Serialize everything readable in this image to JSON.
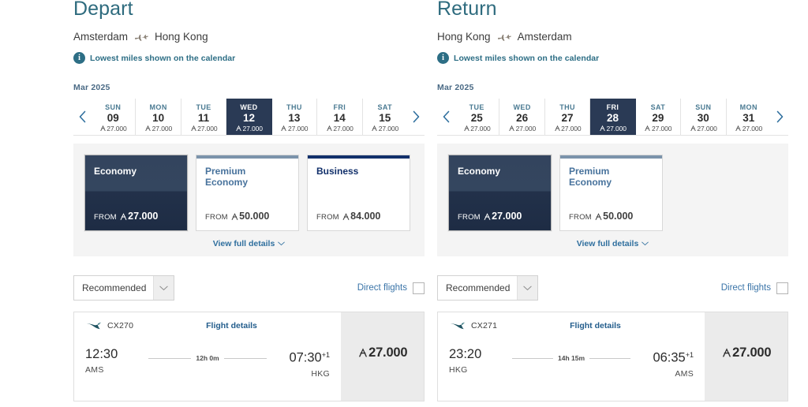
{
  "brand": {
    "accent_teal": "#2e6b7e",
    "accent_blue": "#2f6f9e",
    "navy_dark": "#2a3a55",
    "business_navy": "#12306b",
    "premium_blue": "#7b93ab",
    "miles_symbol": "asia-miles-A"
  },
  "panels": [
    {
      "key": "depart",
      "title": "Depart",
      "route": {
        "origin": "Amsterdam",
        "destination": "Hong Kong",
        "icon": "airplane-icon"
      },
      "notice": {
        "icon": "info-icon",
        "text": "Lowest miles shown on the calendar"
      },
      "month": "Mar 2025",
      "calendar": {
        "prev_label": "‹",
        "next_label": "›",
        "days": [
          {
            "dow": "SUN",
            "num": "09",
            "miles": "27.000",
            "selected": false
          },
          {
            "dow": "MON",
            "num": "10",
            "miles": "27.000",
            "selected": false
          },
          {
            "dow": "TUE",
            "num": "11",
            "miles": "27.000",
            "selected": false
          },
          {
            "dow": "WED",
            "num": "12",
            "miles": "27.000",
            "selected": true
          },
          {
            "dow": "THU",
            "num": "13",
            "miles": "27.000",
            "selected": false
          },
          {
            "dow": "FRI",
            "num": "14",
            "miles": "27.000",
            "selected": false
          },
          {
            "dow": "SAT",
            "num": "15",
            "miles": "27.000",
            "selected": false
          }
        ]
      },
      "cabins": [
        {
          "name": "Economy",
          "from_label": "FROM",
          "price": "27.000",
          "state": "selected"
        },
        {
          "name": "Premium Economy",
          "from_label": "FROM",
          "price": "50.000",
          "state": "premium"
        },
        {
          "name": "Business",
          "from_label": "FROM",
          "price": "84.000",
          "state": "business"
        }
      ],
      "view_details": {
        "label": "View full details",
        "icon": "chevron-down-icon"
      },
      "filters": {
        "sort_value": "Recommended",
        "sort_caret": "chevron-down-icon",
        "direct_label": "Direct flights",
        "direct_checked": false
      },
      "flight": {
        "carrier_icon": "cathay-brushwing-icon",
        "flight_number": "CX270",
        "details_link": "Flight details",
        "depart_time": "12:30",
        "depart_airport": "AMS",
        "duration": "12h 0m",
        "arrive_time": "07:30",
        "arrive_day_offset": "+1",
        "arrive_airport": "HKG",
        "price": "27.000"
      }
    },
    {
      "key": "return",
      "title": "Return",
      "route": {
        "origin": "Hong Kong",
        "destination": "Amsterdam",
        "icon": "airplane-icon"
      },
      "notice": {
        "icon": "info-icon",
        "text": "Lowest miles shown on the calendar"
      },
      "month": "Mar 2025",
      "calendar": {
        "prev_label": "‹",
        "next_label": "›",
        "days": [
          {
            "dow": "TUE",
            "num": "25",
            "miles": "27.000",
            "selected": false
          },
          {
            "dow": "WED",
            "num": "26",
            "miles": "27.000",
            "selected": false
          },
          {
            "dow": "THU",
            "num": "27",
            "miles": "27.000",
            "selected": false
          },
          {
            "dow": "FRI",
            "num": "28",
            "miles": "27.000",
            "selected": true
          },
          {
            "dow": "SAT",
            "num": "29",
            "miles": "27.000",
            "selected": false
          },
          {
            "dow": "SUN",
            "num": "30",
            "miles": "27.000",
            "selected": false
          },
          {
            "dow": "MON",
            "num": "31",
            "miles": "27.000",
            "selected": false
          }
        ]
      },
      "cabins": [
        {
          "name": "Economy",
          "from_label": "FROM",
          "price": "27.000",
          "state": "selected"
        },
        {
          "name": "Premium Economy",
          "from_label": "FROM",
          "price": "50.000",
          "state": "premium"
        }
      ],
      "view_details": {
        "label": "View full details",
        "icon": "chevron-down-icon"
      },
      "filters": {
        "sort_value": "Recommended",
        "sort_caret": "chevron-down-icon",
        "direct_label": "Direct flights",
        "direct_checked": false
      },
      "flight": {
        "carrier_icon": "cathay-brushwing-icon",
        "flight_number": "CX271",
        "details_link": "Flight details",
        "depart_time": "23:20",
        "depart_airport": "HKG",
        "duration": "14h 15m",
        "arrive_time": "06:35",
        "arrive_day_offset": "+1",
        "arrive_airport": "AMS",
        "price": "27.000"
      }
    }
  ]
}
